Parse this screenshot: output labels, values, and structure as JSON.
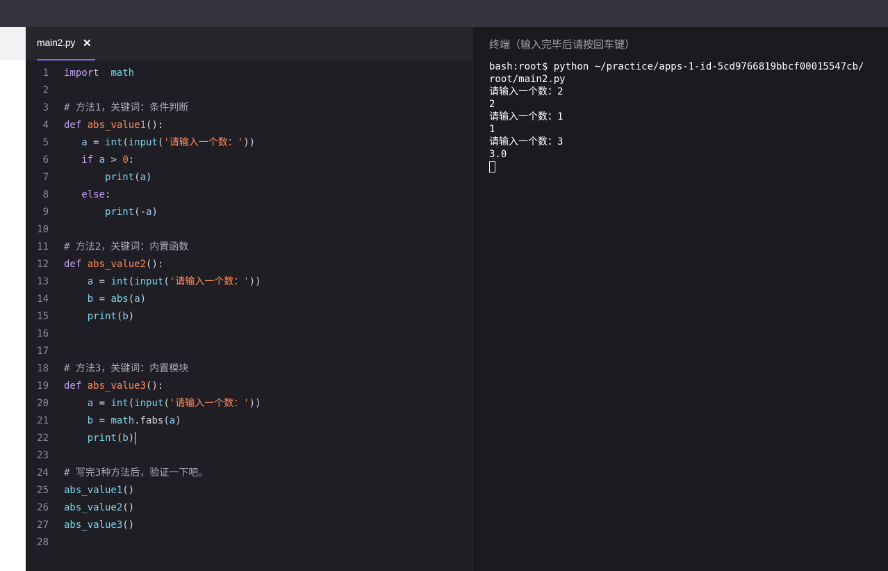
{
  "editor": {
    "tab": {
      "filename": "main2.py",
      "close_glyph": "✕"
    },
    "lines": [
      [
        {
          "t": "import",
          "c": "kw"
        },
        {
          "t": "  "
        },
        {
          "t": "math",
          "c": "bi"
        }
      ],
      [],
      [
        {
          "t": "# 方法1，关键词：条件判断",
          "c": "cm"
        }
      ],
      [
        {
          "t": "def",
          "c": "kw"
        },
        {
          "t": " "
        },
        {
          "t": "abs_value1",
          "c": "fn"
        },
        {
          "t": "():"
        }
      ],
      [
        {
          "t": "   "
        },
        {
          "t": "a",
          "c": "var"
        },
        {
          "t": " = "
        },
        {
          "t": "int",
          "c": "bi"
        },
        {
          "t": "("
        },
        {
          "t": "input",
          "c": "bi"
        },
        {
          "t": "("
        },
        {
          "t": "'请输入一个数：'",
          "c": "str"
        },
        {
          "t": "))"
        }
      ],
      [
        {
          "t": "   "
        },
        {
          "t": "if",
          "c": "kw"
        },
        {
          "t": " "
        },
        {
          "t": "a",
          "c": "var"
        },
        {
          "t": " > "
        },
        {
          "t": "0",
          "c": "num"
        },
        {
          "t": ":"
        }
      ],
      [
        {
          "t": "       "
        },
        {
          "t": "print",
          "c": "bi"
        },
        {
          "t": "("
        },
        {
          "t": "a",
          "c": "var"
        },
        {
          "t": ")"
        }
      ],
      [
        {
          "t": "   "
        },
        {
          "t": "else",
          "c": "kw"
        },
        {
          "t": ":"
        }
      ],
      [
        {
          "t": "       "
        },
        {
          "t": "print",
          "c": "bi"
        },
        {
          "t": "(-"
        },
        {
          "t": "a",
          "c": "var"
        },
        {
          "t": ")"
        }
      ],
      [],
      [
        {
          "t": "# 方法2，关键词：内置函数",
          "c": "cm"
        }
      ],
      [
        {
          "t": "def",
          "c": "kw"
        },
        {
          "t": " "
        },
        {
          "t": "abs_value2",
          "c": "fn"
        },
        {
          "t": "():"
        }
      ],
      [
        {
          "t": "    "
        },
        {
          "t": "a",
          "c": "var"
        },
        {
          "t": " = "
        },
        {
          "t": "int",
          "c": "bi"
        },
        {
          "t": "("
        },
        {
          "t": "input",
          "c": "bi"
        },
        {
          "t": "("
        },
        {
          "t": "'请输入一个数：'",
          "c": "str"
        },
        {
          "t": "))"
        }
      ],
      [
        {
          "t": "    "
        },
        {
          "t": "b",
          "c": "var"
        },
        {
          "t": " = "
        },
        {
          "t": "abs",
          "c": "bi"
        },
        {
          "t": "("
        },
        {
          "t": "a",
          "c": "var"
        },
        {
          "t": ")"
        }
      ],
      [
        {
          "t": "    "
        },
        {
          "t": "print",
          "c": "bi"
        },
        {
          "t": "("
        },
        {
          "t": "b",
          "c": "var"
        },
        {
          "t": ")"
        }
      ],
      [],
      [],
      [
        {
          "t": "# 方法3，关键词：内置模块",
          "c": "cm"
        }
      ],
      [
        {
          "t": "def",
          "c": "kw"
        },
        {
          "t": " "
        },
        {
          "t": "abs_value3",
          "c": "fn"
        },
        {
          "t": "():"
        }
      ],
      [
        {
          "t": "    "
        },
        {
          "t": "a",
          "c": "var"
        },
        {
          "t": " = "
        },
        {
          "t": "int",
          "c": "bi"
        },
        {
          "t": "("
        },
        {
          "t": "input",
          "c": "bi"
        },
        {
          "t": "("
        },
        {
          "t": "'请输入一个数：'",
          "c": "str"
        },
        {
          "t": "))"
        }
      ],
      [
        {
          "t": "    "
        },
        {
          "t": "b",
          "c": "var"
        },
        {
          "t": " = "
        },
        {
          "t": "math",
          "c": "bi"
        },
        {
          "t": ".fabs("
        },
        {
          "t": "a",
          "c": "var"
        },
        {
          "t": ")"
        }
      ],
      [
        {
          "t": "    "
        },
        {
          "t": "print",
          "c": "bi"
        },
        {
          "t": "("
        },
        {
          "t": "b",
          "c": "var"
        },
        {
          "t": ")"
        }
      ],
      [],
      [
        {
          "t": "# 写完3种方法后，验证一下吧。",
          "c": "cm"
        }
      ],
      [
        {
          "t": "abs_value1",
          "c": "bi"
        },
        {
          "t": "()"
        }
      ],
      [
        {
          "t": "abs_value2",
          "c": "bi"
        },
        {
          "t": "()"
        }
      ],
      [
        {
          "t": "abs_value3",
          "c": "bi"
        },
        {
          "t": "()"
        }
      ],
      []
    ],
    "cursor_line": 22
  },
  "terminal": {
    "title": "终端（输入完毕后请按回车键）",
    "lines": [
      "bash:root$ python ~/practice/apps-1-id-5cd9766819bbcf00015547cb/",
      "root/main2.py",
      "请输入一个数：2",
      "2",
      "请输入一个数：1",
      "1",
      "请输入一个数：3",
      "3.0"
    ]
  }
}
